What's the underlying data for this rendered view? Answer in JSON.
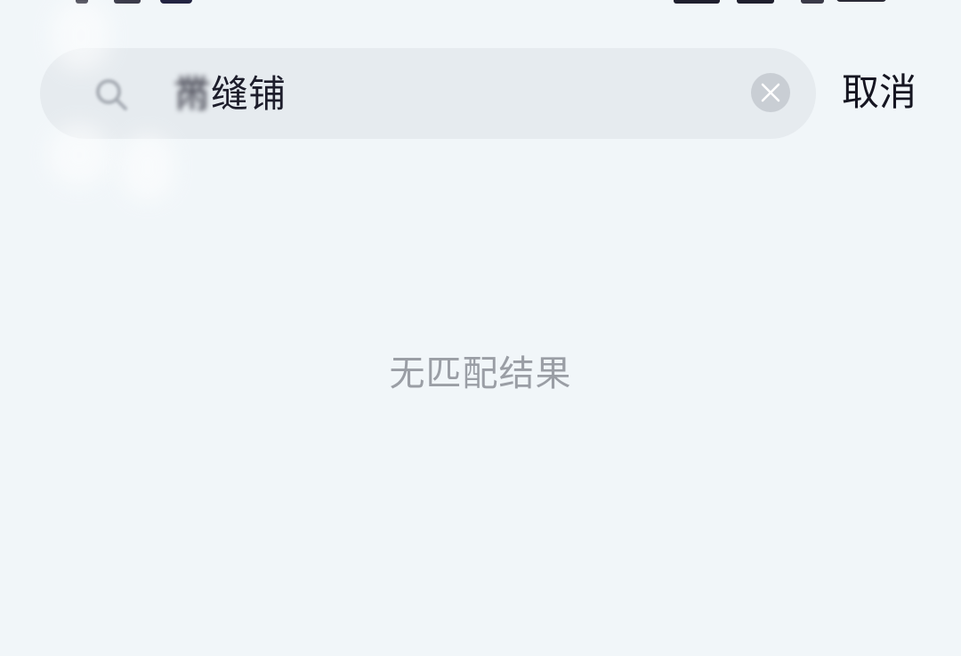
{
  "search": {
    "blurred_text": "黹",
    "visible_text": "缝铺",
    "value": "黹缝铺"
  },
  "cancel_label": "取消",
  "empty_state": {
    "message": "无匹配结果"
  },
  "colors": {
    "background": "#f1f6f9",
    "search_bar": "#e6ebef",
    "clear_button": "#c9ced4",
    "empty_text": "#9a9ea5",
    "primary_text": "#151521"
  },
  "icons": {
    "search": "search-icon",
    "clear": "close-icon"
  }
}
